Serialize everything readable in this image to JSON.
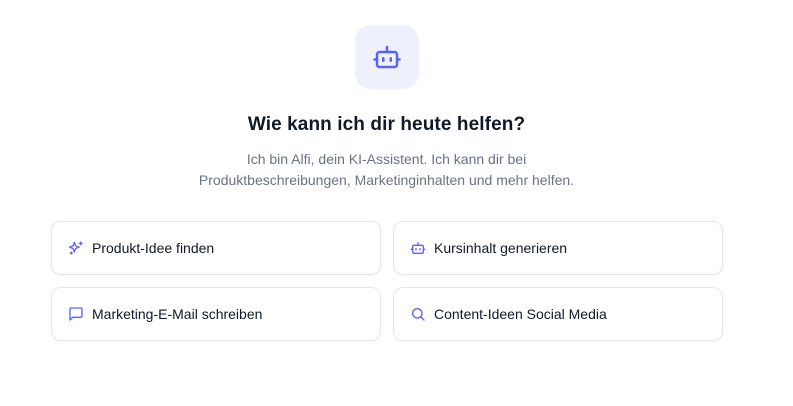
{
  "colors": {
    "accent": "#5b63f5",
    "tile_bg": "#eef0fe",
    "title": "#111827",
    "subtitle": "#6b7280",
    "border": "#e5e7eb"
  },
  "header": {
    "icon": "robot-icon",
    "title": "Wie kann ich dir heute helfen?",
    "subtitle_line1": "Ich bin Alfi, dein KI-Assistent. Ich kann dir bei",
    "subtitle_line2": "Produktbeschreibungen, Marketinginhalten und mehr helfen."
  },
  "suggestions": [
    {
      "icon": "sparkles-icon",
      "label": "Produkt-Idee finden"
    },
    {
      "icon": "robot-icon",
      "label": "Kursinhalt generieren"
    },
    {
      "icon": "message-icon",
      "label": "Marketing-E-Mail schreiben"
    },
    {
      "icon": "search-icon",
      "label": "Content-Ideen Social Media"
    }
  ]
}
